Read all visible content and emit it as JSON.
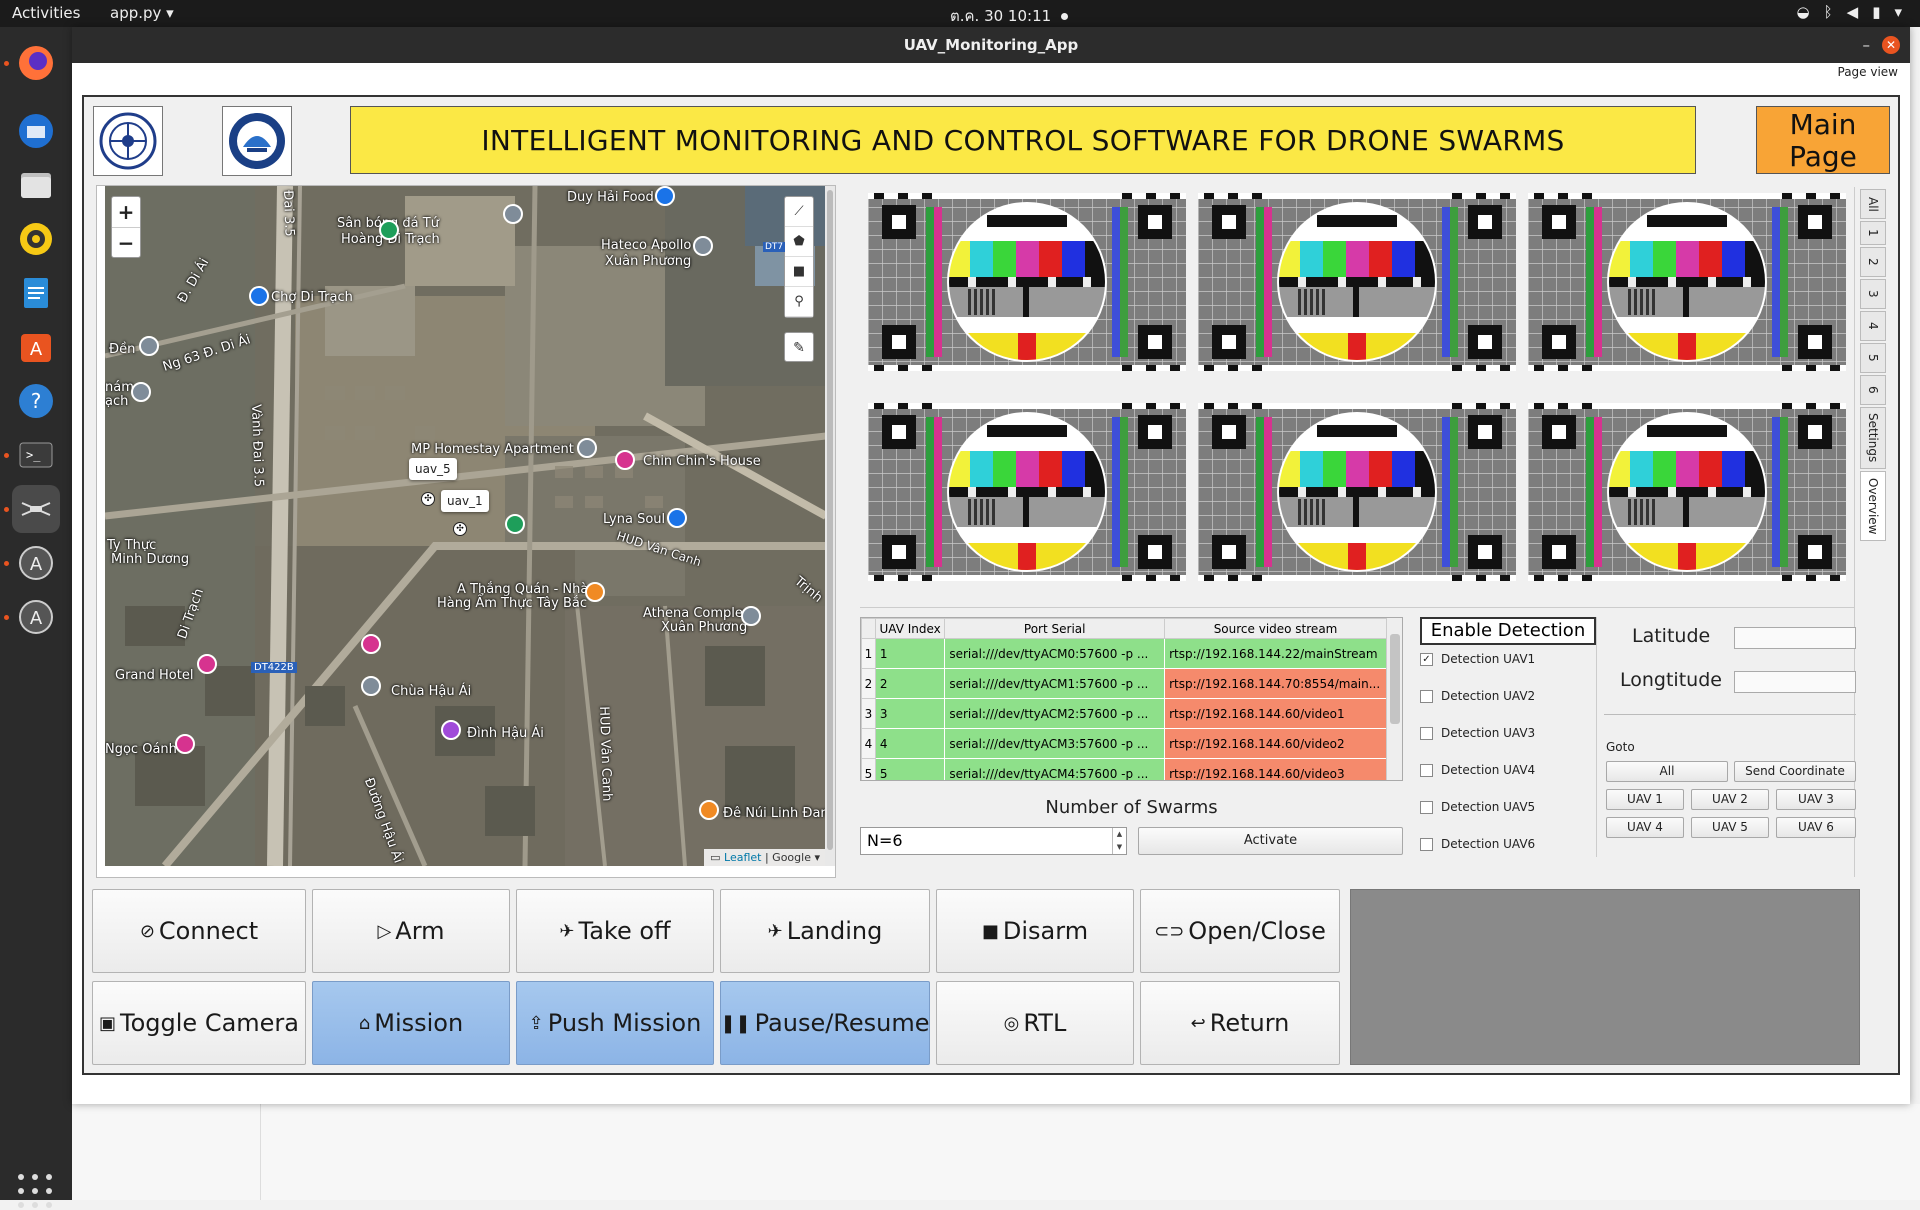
{
  "topbar": {
    "activities": "Activities",
    "app_menu": "app.py ▾",
    "clock": "ต.ค. 30  10:11"
  },
  "window": {
    "title": "UAV_Monitoring_App",
    "page_view": "Page view"
  },
  "header": {
    "banner": "INTELLIGENT MONITORING AND CONTROL SOFTWARE FOR DRONE SWARMS",
    "main_page_line1": "Main",
    "main_page_line2": "Page"
  },
  "map": {
    "zoom_in": "+",
    "zoom_out": "−",
    "attribution_leaflet": "Leaflet",
    "attribution_sep": " | Google",
    "labels": [
      "Duy Hải Food",
      "Sân bóng đá Tứ",
      "Hoàng Di Trạch",
      "Hateco Apollo",
      "Xuân Phương",
      "Chợ Di Trạch",
      "Đền",
      "Ng 63 Đ. Di Ái",
      "nám",
      "ạch",
      "MP Homestay Apartment",
      "Chin Chin's House",
      "Lyna Soul",
      "HUD Vân Canh",
      "Ty Thực",
      "Minh Dương",
      "A Thắng Quán - Nhà",
      "Hàng Ẩm Thực Tây Bắc",
      "Athena Complex",
      "Xuân Phương",
      "Grand Hotel",
      "DT422B",
      "Chùa Hậu Ái",
      "Đình Hậu Ái",
      "Ngọc Oánh",
      "Đê Núi Linh Đan",
      "Vành Đai 3.5",
      "Đai 3.5",
      "Đường Hậu Ái",
      "HUD Vân Canh",
      "Trịnh",
      "DT7",
      "Đ. Di Ái",
      "Di Trạch"
    ],
    "uav_tags": [
      "uav_5",
      "uav_1"
    ]
  },
  "side_tabs": [
    "All",
    "1",
    "2",
    "3",
    "4",
    "5",
    "6",
    "Settings",
    "Overview"
  ],
  "table": {
    "headers": [
      "UAV Index",
      "Port Serial",
      "Source video stream"
    ],
    "rows": [
      {
        "n": "1",
        "index": "1",
        "port": "serial:///dev/ttyACM0:57600 -p ...",
        "stream": "rtsp://192.168.144.22/mainStream",
        "stream_ok": true
      },
      {
        "n": "2",
        "index": "2",
        "port": "serial:///dev/ttyACM1:57600 -p ...",
        "stream": "rtsp://192.168.144.70:8554/main...",
        "stream_ok": false
      },
      {
        "n": "3",
        "index": "3",
        "port": "serial:///dev/ttyACM2:57600 -p ...",
        "stream": "rtsp://192.168.144.60/video1",
        "stream_ok": false
      },
      {
        "n": "4",
        "index": "4",
        "port": "serial:///dev/ttyACM3:57600 -p ...",
        "stream": "rtsp://192.168.144.60/video2",
        "stream_ok": false
      },
      {
        "n": "5",
        "index": "5",
        "port": "serial:///dev/ttyACM4:57600 -p ...",
        "stream": "rtsp://192.168.144.60/video3",
        "stream_ok": false
      }
    ]
  },
  "swarm": {
    "label": "Number of Swarms",
    "value": "N=6",
    "activate": "Activate"
  },
  "detection": {
    "title": "Enable Detection",
    "items": [
      {
        "label": "Detection UAV1",
        "checked": true
      },
      {
        "label": "Detection UAV2",
        "checked": false
      },
      {
        "label": "Detection UAV3",
        "checked": false
      },
      {
        "label": "Detection UAV4",
        "checked": false
      },
      {
        "label": "Detection UAV5",
        "checked": false
      },
      {
        "label": "Detection UAV6",
        "checked": false
      }
    ]
  },
  "coords": {
    "latitude": "Latitude",
    "longitude": "Longtitude",
    "goto": "Goto",
    "all": "All",
    "send": "Send Coordinate",
    "uav_buttons": [
      "UAV 1",
      "UAV 2",
      "UAV 3",
      "UAV 4",
      "UAV 5",
      "UAV 6"
    ]
  },
  "controls": {
    "connect": "Connect",
    "arm": "Arm",
    "takeoff": "Take off",
    "landing": "Landing",
    "disarm": "Disarm",
    "open_close": "Open/Close",
    "toggle_camera": "Toggle Camera",
    "mission": "Mission",
    "push_mission": "Push Mission",
    "pause_resume": "Pause/Resume",
    "rtl": "RTL",
    "return": "Return"
  },
  "colors": {
    "banner": "#fbe845",
    "main_page": "#f8a436",
    "mission_blue": "#9cc0ec",
    "stream_ok": "#8ee08a",
    "stream_bad": "#f58a6c",
    "accent": "#e95420"
  }
}
